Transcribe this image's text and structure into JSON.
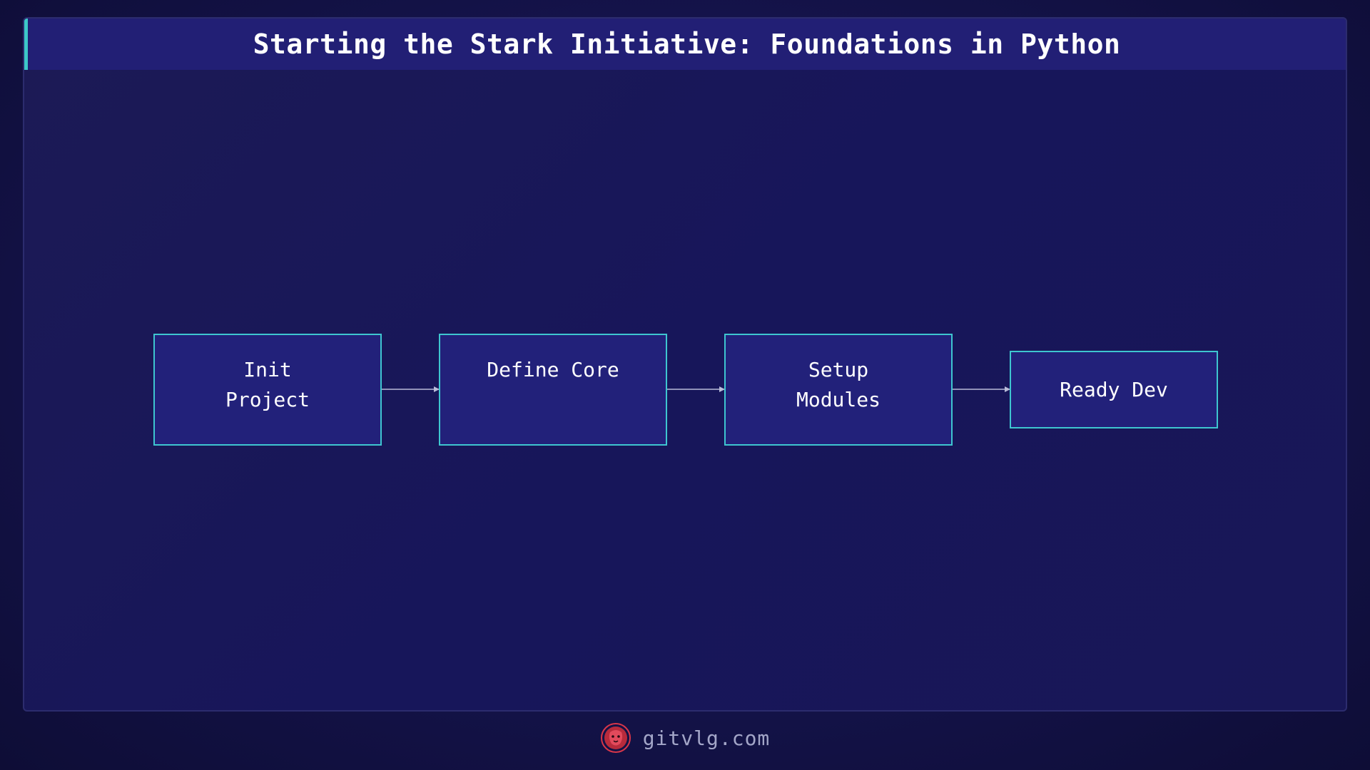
{
  "title": "Starting the Stark Initiative: Foundations in Python",
  "diagram": {
    "nodes": [
      {
        "id": "init",
        "label": "Init\nProject"
      },
      {
        "id": "core",
        "label": "Define Core"
      },
      {
        "id": "modules",
        "label": "Setup\nModules"
      },
      {
        "id": "ready",
        "label": "Ready Dev"
      }
    ],
    "edges": [
      {
        "from": "init",
        "to": "core"
      },
      {
        "from": "core",
        "to": "modules"
      },
      {
        "from": "modules",
        "to": "ready"
      }
    ]
  },
  "footer": {
    "site": "gitvlg.com",
    "logo_icon": "lion-head-icon"
  },
  "colors": {
    "node_fill": "#22217a",
    "node_border": "#3ec6d0",
    "accent": "#3cc8c8",
    "arrow": "#b9bcd8",
    "logo": "#d8364a"
  }
}
